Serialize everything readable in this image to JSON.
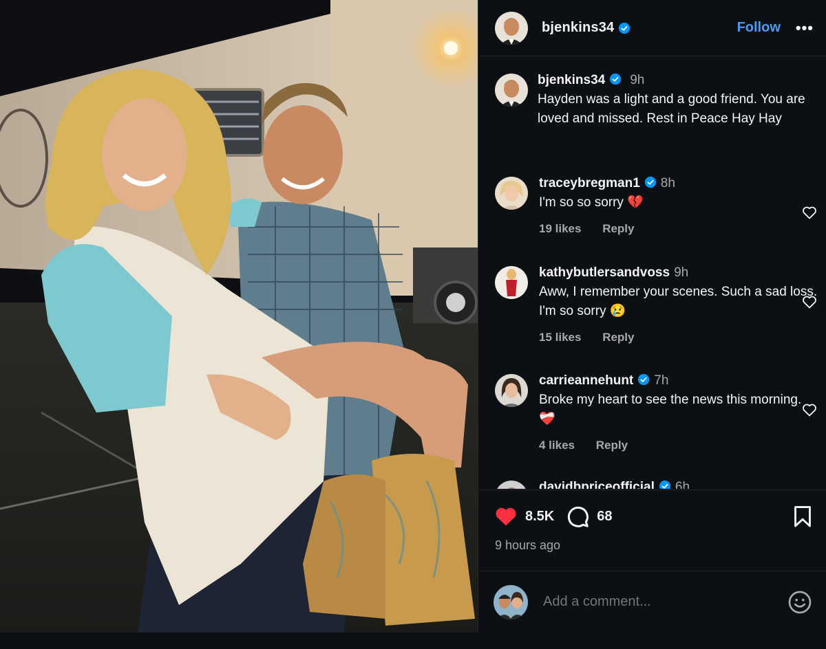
{
  "post": {
    "author": "bjenkins34",
    "follow_label": "Follow",
    "more_label": "•••",
    "caption": {
      "author": "bjenkins34",
      "time": "9h",
      "text": "Hayden was a light and a good friend. You are loved and missed. Rest in Peace Hay Hay"
    },
    "likes_count": "8.5K",
    "comments_count": "68",
    "time_ago": "9 hours ago",
    "add_comment_placeholder": "Add a comment..."
  },
  "comments": [
    {
      "author": "traceybregman1",
      "verified": true,
      "time": "8h",
      "text": "I'm so so sorry 💔",
      "likes": "19 likes",
      "reply": "Reply"
    },
    {
      "author": "kathybutlersandvoss",
      "verified": false,
      "time": "9h",
      "text": "Aww, I remember your scenes. Such a sad loss. I'm so sorry 😢",
      "likes": "15 likes",
      "reply": "Reply"
    },
    {
      "author": "carrieannehunt",
      "verified": true,
      "time": "7h",
      "text": "Broke my heart to see the news this morning. ❤️‍🩹",
      "likes": "4 likes",
      "reply": "Reply"
    },
    {
      "author": "davidbpriceofficial",
      "verified": true,
      "time": "6h",
      "text": "",
      "likes": "",
      "reply": ""
    }
  ],
  "colors": {
    "accent_blue": "#4a9cf6",
    "verified_blue": "#0095f6",
    "like_red": "#ff3040",
    "panel_bg": "#0c1014",
    "muted_text": "#a8a8a8"
  },
  "icons": [
    "verified-icon",
    "heart-icon",
    "comment-icon",
    "bookmark-icon",
    "emoji-icon",
    "more-icon"
  ]
}
